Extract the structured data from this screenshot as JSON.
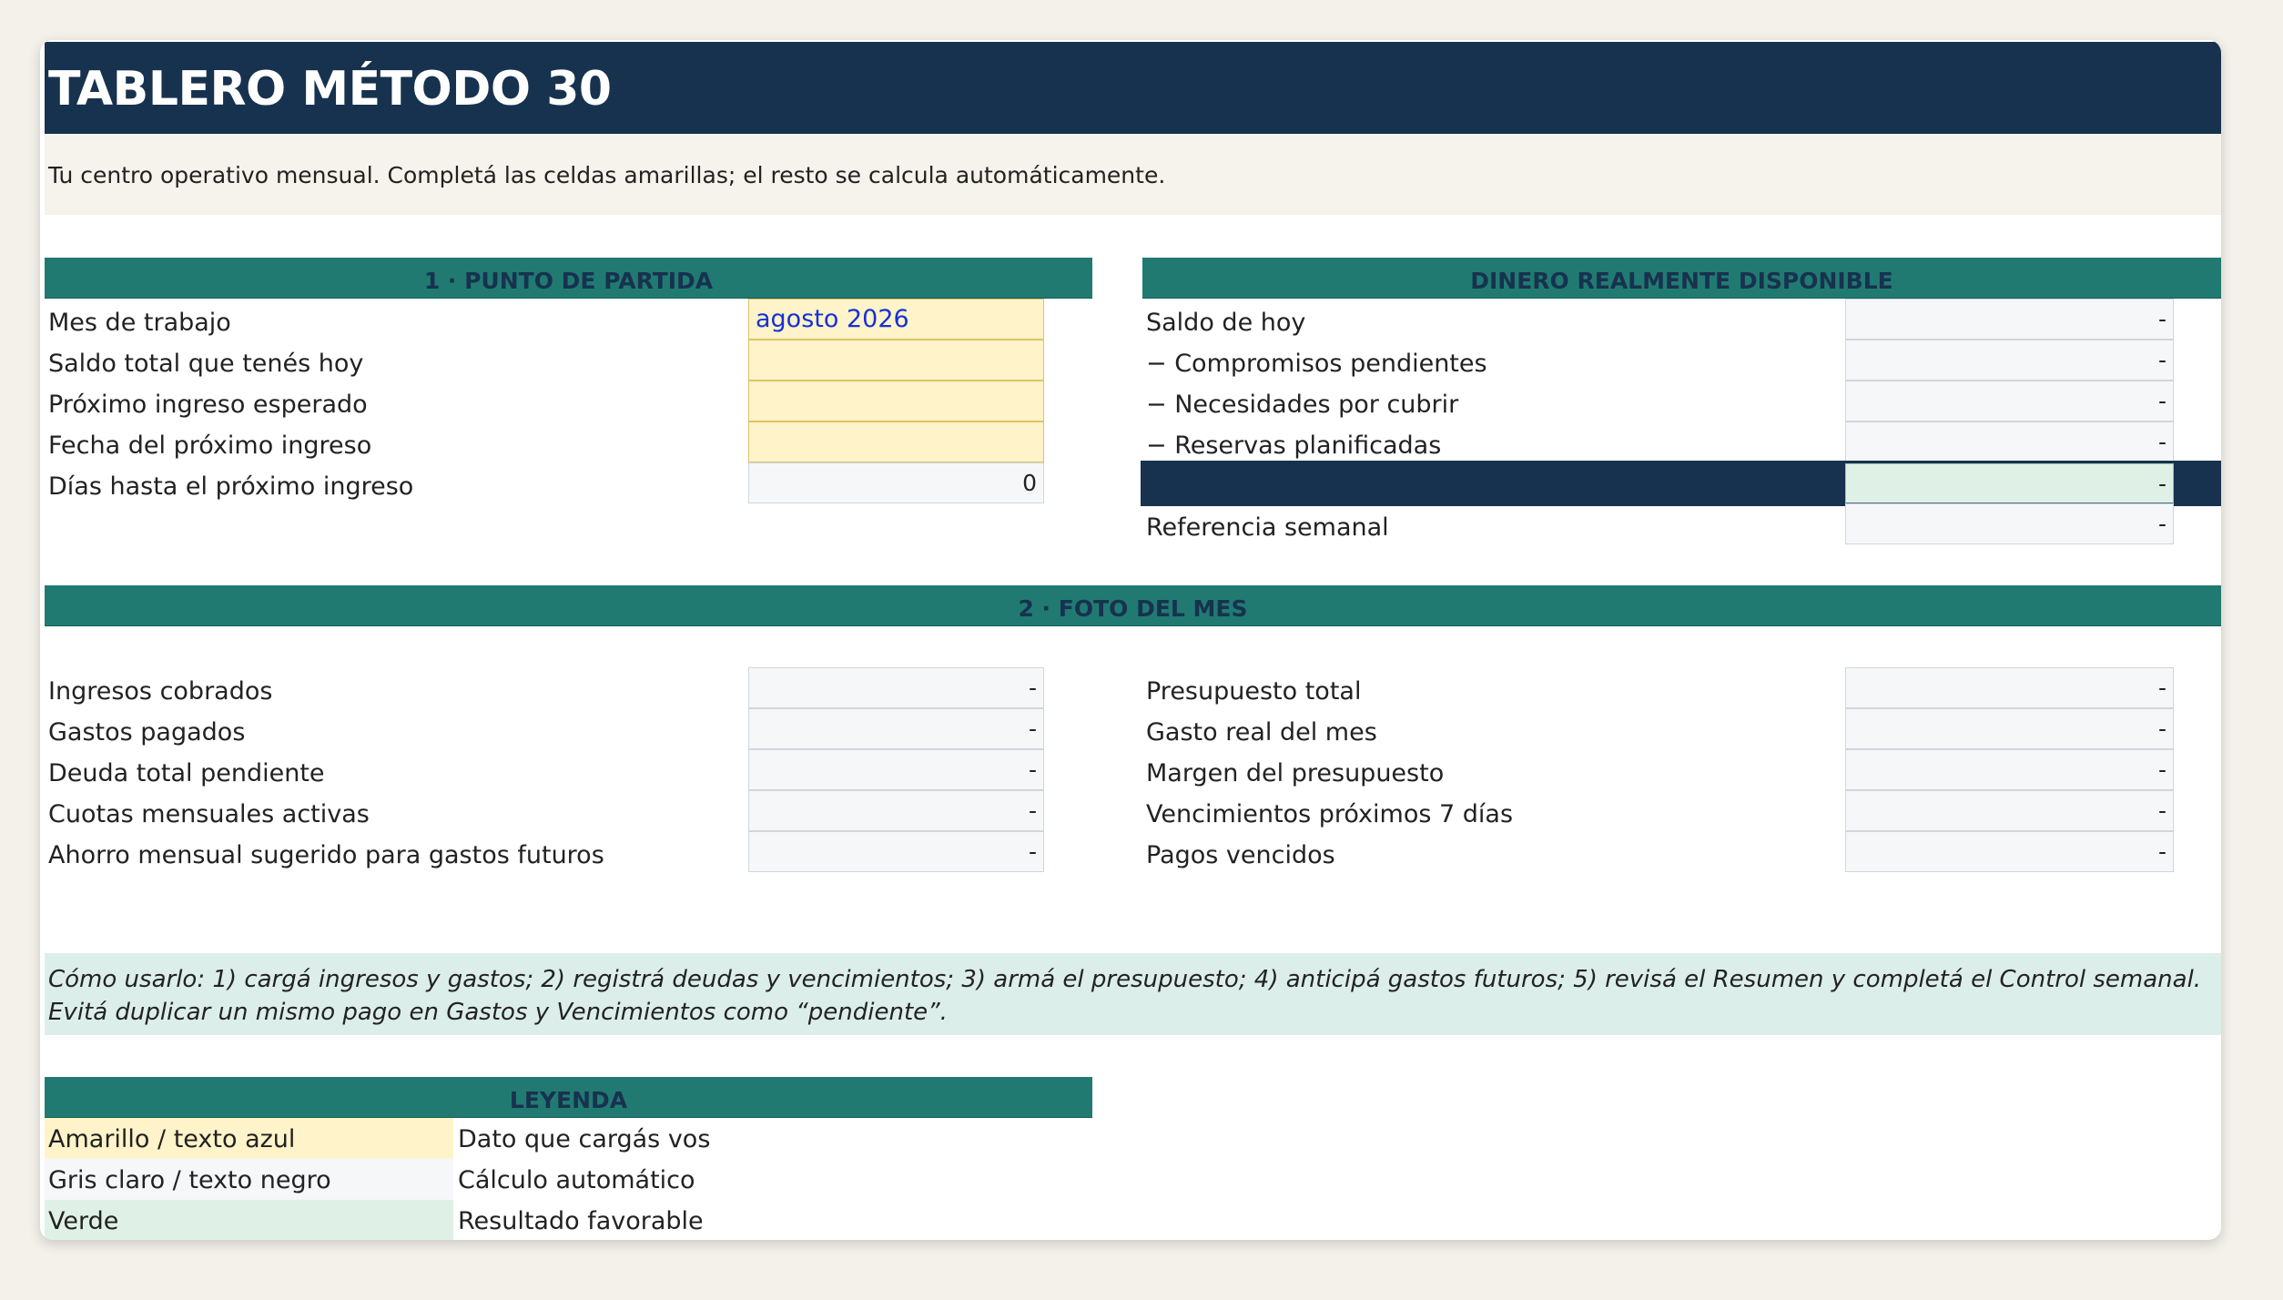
{
  "header": {
    "title": "TABLERO MÉTODO 30",
    "subtitle": "Tu centro operativo mensual. Completá las celdas amarillas; el resto se calcula automáticamente."
  },
  "section1": {
    "heading": "1 · PUNTO DE PARTIDA",
    "rows": [
      {
        "label": "Mes de trabajo",
        "value": "agosto 2026"
      },
      {
        "label": "Saldo total que tenés hoy",
        "value": ""
      },
      {
        "label": "Próximo ingreso esperado",
        "value": ""
      },
      {
        "label": "Fecha del próximo ingreso",
        "value": ""
      },
      {
        "label": "Días hasta el próximo ingreso",
        "value": "0"
      }
    ]
  },
  "available": {
    "heading": "DINERO REALMENTE DISPONIBLE",
    "rows": [
      {
        "label": "Saldo de hoy",
        "value": "-"
      },
      {
        "label": "− Compromisos pendientes",
        "value": "-"
      },
      {
        "label": "− Necesidades por cubrir",
        "value": "-"
      },
      {
        "label": "− Reservas planificadas",
        "value": "-"
      },
      {
        "label": "",
        "value": "-"
      },
      {
        "label": "Referencia semanal",
        "value": "-"
      }
    ]
  },
  "section2": {
    "heading": "2 · FOTO DEL MES",
    "left": [
      {
        "label": "Ingresos cobrados",
        "value": "-"
      },
      {
        "label": "Gastos pagados",
        "value": "-"
      },
      {
        "label": "Deuda total pendiente",
        "value": "-"
      },
      {
        "label": "Cuotas mensuales activas",
        "value": "-"
      },
      {
        "label": "Ahorro mensual sugerido para gastos futuros",
        "value": "-"
      }
    ],
    "right": [
      {
        "label": "Presupuesto total",
        "value": "-"
      },
      {
        "label": "Gasto real del mes",
        "value": "-"
      },
      {
        "label": "Margen del presupuesto",
        "value": "-"
      },
      {
        "label": "Vencimientos próximos 7 días",
        "value": "-"
      },
      {
        "label": "Pagos vencidos",
        "value": "-"
      }
    ]
  },
  "how_to": "Cómo usarlo: 1) cargá ingresos y gastos; 2) registrá deudas y vencimientos; 3) armá el presupuesto; 4) anticipá gastos futuros; 5) revisá el Resumen y completá el Control semanal. Evitá duplicar un mismo pago en Gastos y Vencimientos como “pendiente”.",
  "legend": {
    "heading": "LEYENDA",
    "rows": [
      {
        "swatch": "Amarillo / texto azul",
        "meaning": "Dato que cargás vos"
      },
      {
        "swatch": "Gris claro / texto negro",
        "meaning": "Cálculo automático"
      },
      {
        "swatch": "Verde",
        "meaning": "Resultado favorable"
      }
    ]
  },
  "colors": {
    "navy": "#17324e",
    "teal": "#217a72",
    "input_yellow": "#fff3c9",
    "calc_gray": "#f6f7f9",
    "good_green": "#dff1e6",
    "input_text_blue": "#1531d8"
  }
}
